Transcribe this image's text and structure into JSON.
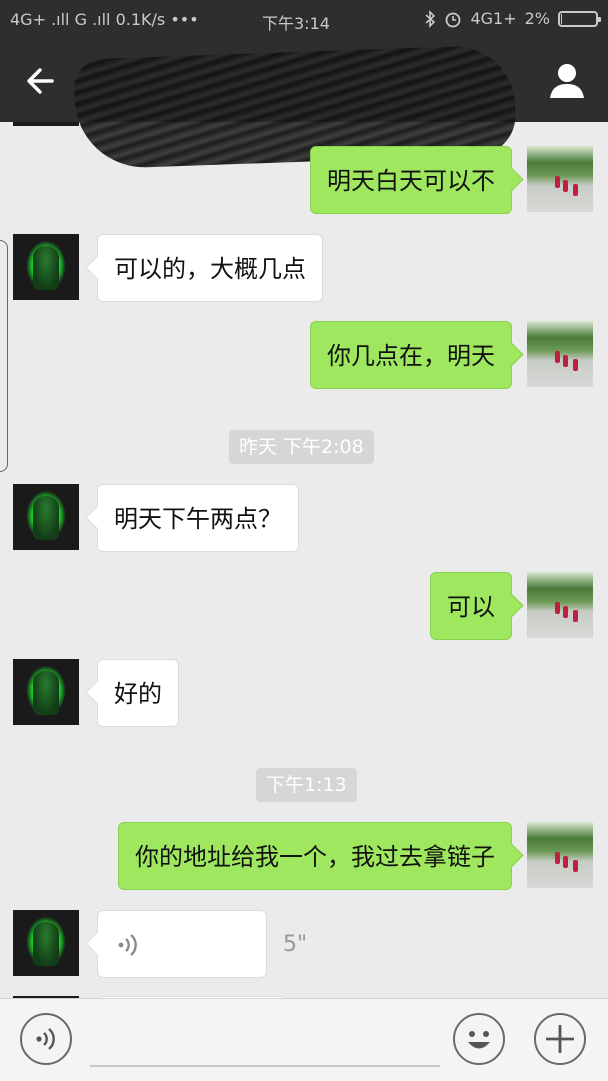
{
  "status_bar": {
    "left": "4G+ .ıll G .ıll 0.1K/s •••",
    "time": "下午3:14",
    "network": "4G1+",
    "battery": "2%",
    "battery_level": 0.02
  },
  "header": {
    "title": ""
  },
  "messages": [
    {
      "type": "sent",
      "text": "明天白天可以不"
    },
    {
      "type": "received",
      "text": "可以的，大概几点"
    },
    {
      "type": "sent",
      "text": "你几点在，明天"
    },
    {
      "type": "timestamp",
      "text": "昨天 下午2:08"
    },
    {
      "type": "received",
      "text": "明天下午两点？"
    },
    {
      "type": "sent",
      "text": "可以"
    },
    {
      "type": "received",
      "text": "好的"
    },
    {
      "type": "timestamp",
      "text": "下午1:13"
    },
    {
      "type": "sent",
      "text": "你的地址给我一个，我过去拿链子"
    },
    {
      "type": "received_voice",
      "duration": "5\""
    }
  ],
  "input_bar": {
    "voice_icon": "voice-toggle-icon",
    "emoji_icon": "emoji-icon",
    "plus_icon": "plus-icon"
  },
  "colors": {
    "header_bg": "#2e2e2e",
    "chat_bg": "#ebebeb",
    "sent_bubble": "#9ee75f",
    "received_bubble": "#ffffff",
    "timestamp_bg": "#d6d6d6"
  }
}
